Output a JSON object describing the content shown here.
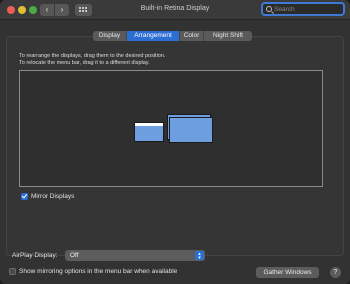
{
  "window": {
    "title": "Built-in Retina Display"
  },
  "titlebar": {
    "back_glyph": "‹",
    "forward_glyph": "›",
    "grid_icon": "grid-icon"
  },
  "search": {
    "placeholder": "Search",
    "value": ""
  },
  "tabs": [
    {
      "label": "Display",
      "active": false
    },
    {
      "label": "Arrangement",
      "active": true
    },
    {
      "label": "Color",
      "active": false
    },
    {
      "label": "Night Shift",
      "active": false
    }
  ],
  "arrangement": {
    "instruction_1": "To rearrange the displays, drag them to the desired position.",
    "instruction_2": "To relocate the menu bar, drag it to a different display.",
    "display_color": "#6d9ee0",
    "mirror_label": "Mirror Displays",
    "mirror_checked": true
  },
  "airplay": {
    "label": "AirPlay Display:",
    "value": "Off"
  },
  "show_mirroring": {
    "label": "Show mirroring options in the menu bar when available",
    "checked": false
  },
  "buttons": {
    "gather": "Gather Windows",
    "help": "?"
  },
  "colors": {
    "accent": "#2c6fd4",
    "window_bg": "#323232"
  }
}
